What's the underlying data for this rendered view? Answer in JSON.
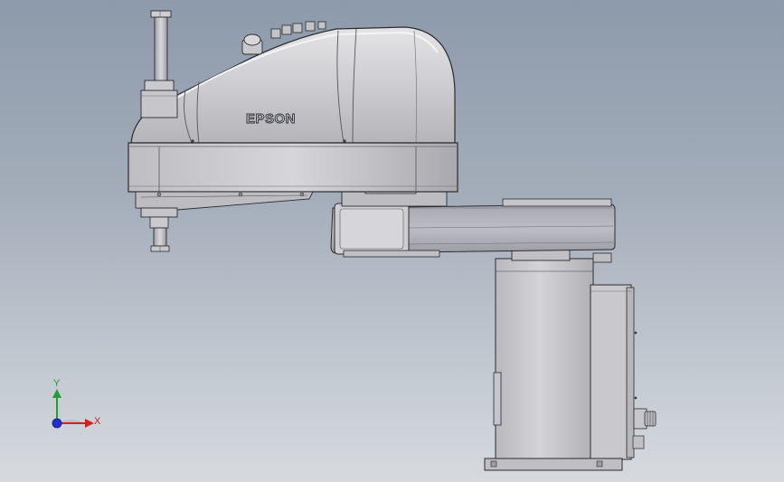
{
  "viewport": {
    "background_top": "#8d9aab",
    "background_bottom": "#d6dadf"
  },
  "robot": {
    "brand_label": "EPSON",
    "body_color": "#c9c9cc",
    "outline_color": "#2a2c30"
  },
  "triad": {
    "x_label": "X",
    "y_label": "Y",
    "x_color": "#d62020",
    "y_color": "#20a030",
    "z_color": "#2030d0"
  }
}
